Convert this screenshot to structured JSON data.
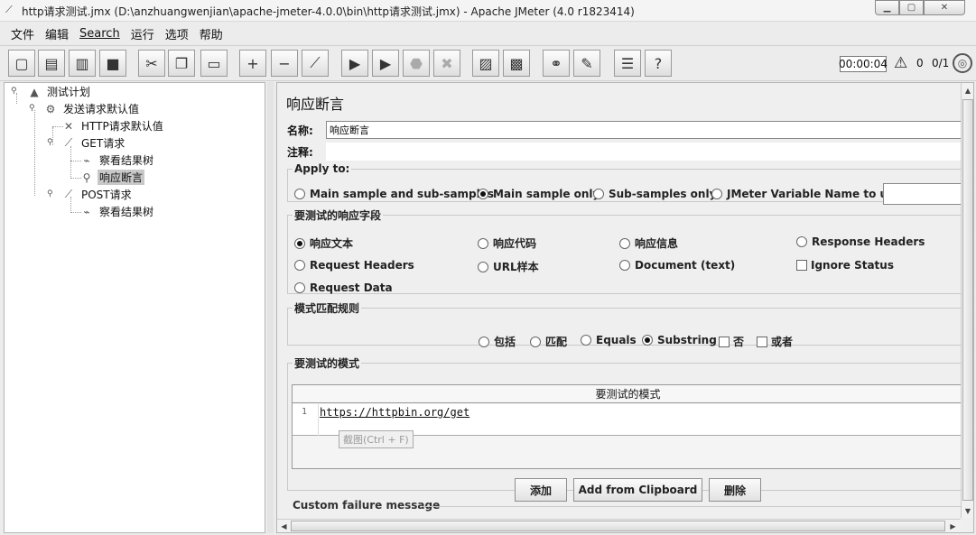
{
  "window": {
    "title": "http请求测试.jmx (D:\\anzhuangwenjian\\apache-jmeter-4.0.0\\bin\\http请求测试.jmx) - Apache JMeter (4.0 r1823414)",
    "icon": "feather-icon"
  },
  "menu": [
    "文件",
    "编辑",
    "Search",
    "运行",
    "选项",
    "帮助"
  ],
  "toolbar": {
    "buttons": [
      {
        "name": "new-icon",
        "glyph": "▢"
      },
      {
        "name": "templates-icon",
        "glyph": "▤"
      },
      {
        "name": "open-icon",
        "glyph": "▥"
      },
      {
        "name": "save-icon",
        "glyph": "■"
      },
      {
        "name": "cut-icon",
        "glyph": "✂"
      },
      {
        "name": "copy-icon",
        "glyph": "❐"
      },
      {
        "name": "paste-icon",
        "glyph": "▭"
      },
      {
        "name": "expand-icon",
        "glyph": "+"
      },
      {
        "name": "collapse-icon",
        "glyph": "−"
      },
      {
        "name": "toggle-icon",
        "glyph": "⟋"
      },
      {
        "name": "start-icon",
        "glyph": "▶"
      },
      {
        "name": "start-no-pause-icon",
        "glyph": "▶"
      },
      {
        "name": "stop-icon",
        "glyph": "⬣"
      },
      {
        "name": "shutdown-icon",
        "glyph": "✖"
      },
      {
        "name": "clear-icon",
        "glyph": "▨"
      },
      {
        "name": "clear-all-icon",
        "glyph": "▩"
      },
      {
        "name": "search-icon",
        "glyph": "⚭"
      },
      {
        "name": "reset-search-icon",
        "glyph": "✎"
      },
      {
        "name": "function-helper-icon",
        "glyph": "☰"
      },
      {
        "name": "help-icon",
        "glyph": "?"
      }
    ],
    "timer": "00:00:04",
    "warning_count": "0",
    "threads": "0/1"
  },
  "tree": {
    "nodes": [
      {
        "label": "测试计划",
        "icon": "flask-icon",
        "glyph": "▲"
      },
      {
        "label": "发送请求默认值",
        "icon": "gear-icon",
        "glyph": "⚙"
      },
      {
        "label": "HTTP请求默认值",
        "icon": "wrench-icon",
        "glyph": "✕"
      },
      {
        "label": "GET请求",
        "icon": "pipette-icon",
        "glyph": "⟋"
      },
      {
        "label": "察看结果树",
        "icon": "chart-icon",
        "glyph": "⌁"
      },
      {
        "label": "响应断言",
        "icon": "magnifier-icon",
        "glyph": "⚲"
      },
      {
        "label": "POST请求",
        "icon": "pipette-icon",
        "glyph": "⟋"
      },
      {
        "label": "察看结果树",
        "icon": "chart-icon",
        "glyph": "⌁"
      }
    ]
  },
  "panel": {
    "title": "响应断言",
    "name_label": "名称:",
    "name_value": "响应断言",
    "comment_label": "注释:",
    "apply_to": {
      "legend": "Apply to:",
      "options": [
        "Main sample and sub-samples",
        "Main sample only",
        "Sub-samples only",
        "JMeter Variable Name to use"
      ],
      "selected": 1
    },
    "fields": {
      "legend": "要测试的响应字段",
      "options": [
        "响应文本",
        "响应代码",
        "响应信息",
        "Response Headers",
        "Request Headers",
        "URL样本",
        "Document (text)",
        "Ignore Status",
        "Request Data"
      ],
      "selected": 0
    },
    "rules": {
      "legend": "模式匹配规则",
      "options": [
        "包括",
        "匹配",
        "Equals",
        "Substring",
        "否",
        "或者"
      ],
      "selected": 3
    },
    "patterns": {
      "legend": "要测试的模式",
      "column_header": "要测试的模式",
      "line_number": "1",
      "value": "https://httpbin.org/get",
      "tooltip": "截图(Ctrl + F)"
    },
    "buttons": {
      "add": "添加",
      "add_clipboard": "Add from Clipboard",
      "delete": "删除"
    },
    "custom_failure": "Custom failure message"
  }
}
